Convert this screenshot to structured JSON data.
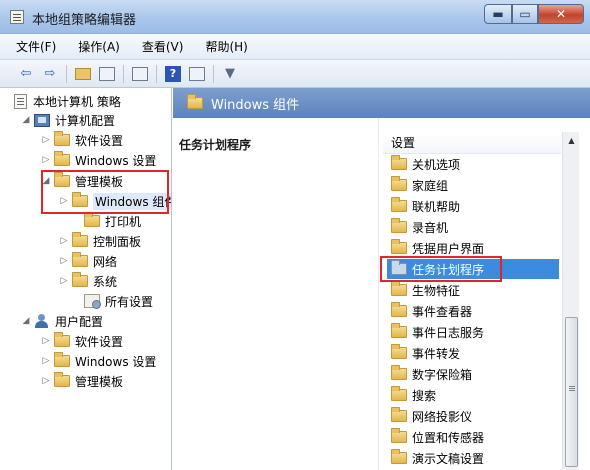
{
  "window": {
    "title": "本地组策略编辑器",
    "controls": {
      "minimize": "▬",
      "maximize": "▭",
      "close": "✕"
    }
  },
  "menubar": {
    "items": [
      {
        "label": "文件(F)"
      },
      {
        "label": "操作(A)"
      },
      {
        "label": "查看(V)"
      },
      {
        "label": "帮助(H)"
      }
    ]
  },
  "toolbar": {
    "back_icon": "⇦",
    "forward_icon": "⇨",
    "help_glyph": "?"
  },
  "tree": {
    "root": "本地计算机 策略",
    "computer_config": "计算机配置",
    "cc_software": "软件设置",
    "cc_windows": "Windows 设置",
    "cc_admin": "管理模板",
    "cc_admin_windows": "Windows 组件",
    "cc_admin_printer": "打印机",
    "cc_admin_control": "控制面板",
    "cc_admin_network": "网络",
    "cc_admin_system": "系统",
    "cc_admin_all": "所有设置",
    "user_config": "用户配置",
    "uc_software": "软件设置",
    "uc_windows": "Windows 设置",
    "uc_admin": "管理模板"
  },
  "right_pane": {
    "header": "Windows 组件",
    "selected_title": "任务计划程序",
    "column_header": "设置",
    "items": [
      {
        "label": "关机选项"
      },
      {
        "label": "家庭组"
      },
      {
        "label": "联机帮助"
      },
      {
        "label": "录音机"
      },
      {
        "label": "凭据用户界面"
      },
      {
        "label": "任务计划程序"
      },
      {
        "label": "生物特征"
      },
      {
        "label": "事件查看器"
      },
      {
        "label": "事件日志服务"
      },
      {
        "label": "事件转发"
      },
      {
        "label": "数字保险箱"
      },
      {
        "label": "搜索"
      },
      {
        "label": "网络投影仪"
      },
      {
        "label": "位置和传感器"
      },
      {
        "label": "演示文稿设置"
      }
    ],
    "selected_index": 5,
    "scroll_up_glyph": "▲"
  },
  "colors": {
    "highlight_box": "#e0252c",
    "selection": "#3b8bdf",
    "header_bg": "#5b83bd"
  }
}
